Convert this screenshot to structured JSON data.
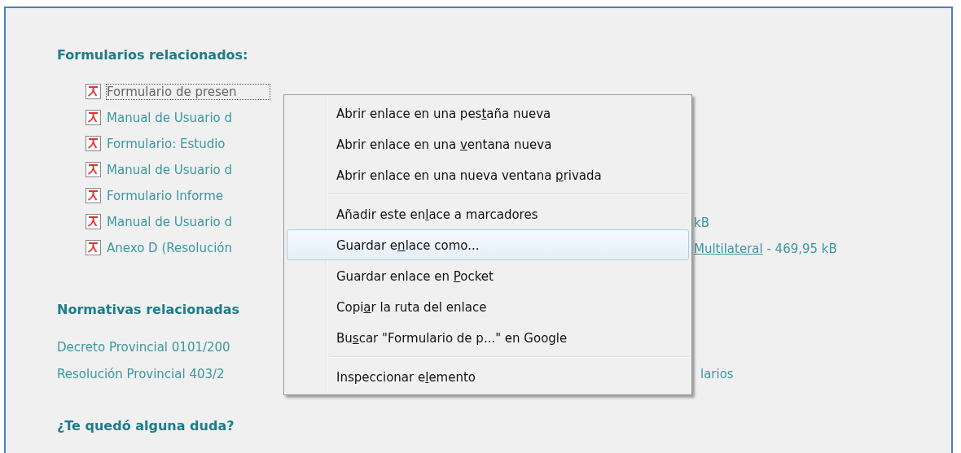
{
  "forms": {
    "heading": "Formularios relacionados:",
    "files": [
      {
        "name": "Formulario de presen",
        "focused": true
      },
      {
        "name": "Manual de Usuario d",
        "focused": false
      },
      {
        "name": "Formulario: Estudio",
        "focused": false
      },
      {
        "name": "Manual de Usuario d",
        "focused": false
      },
      {
        "name": "Formulario Informe",
        "focused": false
      },
      {
        "name": "Manual de Usuario d",
        "focused": false,
        "right": [
          {
            "kind": "text",
            "text": "kB"
          }
        ]
      },
      {
        "name": "Anexo D (Resolución",
        "focused": false,
        "right": [
          {
            "kind": "link",
            "text": "Multilateral"
          },
          {
            "kind": "text",
            "text": " - 469,95 kB"
          }
        ]
      }
    ]
  },
  "regulations": {
    "heading": "Normativas relacionadas",
    "links": [
      {
        "text": "Decreto Provincial 0101/200"
      },
      {
        "text": "Resolución Provincial 403/2",
        "right": "larios"
      }
    ]
  },
  "question": {
    "heading": "¿Te quedó alguna duda?"
  },
  "context_menu": {
    "items": [
      {
        "kind": "item",
        "parts": [
          "Abrir enlace en una pes",
          "t",
          "aña nueva"
        ],
        "selected": false
      },
      {
        "kind": "item",
        "parts": [
          "Abrir enlace en una ",
          "v",
          "entana nueva"
        ],
        "selected": false
      },
      {
        "kind": "item",
        "parts": [
          "Abrir enlace en una nueva ventana ",
          "p",
          "rivada"
        ],
        "selected": false
      },
      {
        "kind": "separator"
      },
      {
        "kind": "item",
        "parts": [
          "Añadir este en",
          "l",
          "ace a marcadores"
        ],
        "selected": false
      },
      {
        "kind": "item",
        "parts": [
          "Guardar e",
          "n",
          "lace como..."
        ],
        "selected": true
      },
      {
        "kind": "item",
        "parts": [
          "Guardar enlace en ",
          "P",
          "ocket"
        ],
        "selected": false
      },
      {
        "kind": "item",
        "parts": [
          "Copi",
          "a",
          "r la ruta del enlace"
        ],
        "selected": false
      },
      {
        "kind": "item",
        "parts": [
          "Bu",
          "s",
          "car \"Formulario de p...\" en Google"
        ],
        "selected": false
      },
      {
        "kind": "separator"
      },
      {
        "kind": "item",
        "parts": [
          "Inspeccionar e",
          "l",
          "emento"
        ],
        "selected": false
      }
    ]
  }
}
